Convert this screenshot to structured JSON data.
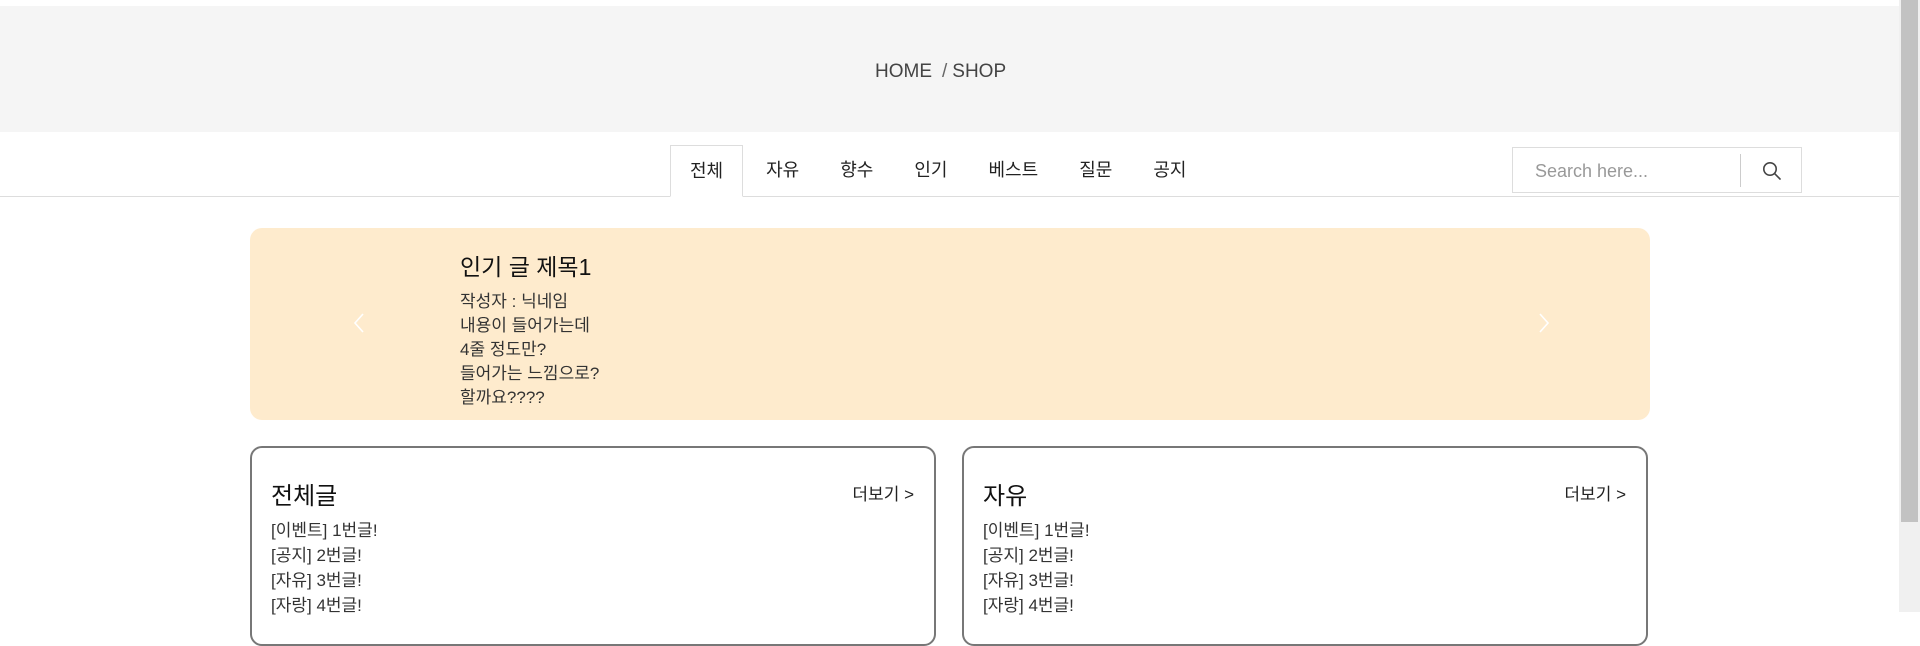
{
  "header": {
    "breadcrumb": {
      "home": "HOME",
      "separator": "/",
      "current": "SHOP"
    }
  },
  "nav": {
    "tabs": [
      {
        "label": "전체",
        "active": true
      },
      {
        "label": "자유"
      },
      {
        "label": "향수"
      },
      {
        "label": "인기"
      },
      {
        "label": "베스트"
      },
      {
        "label": "질문"
      },
      {
        "label": "공지"
      }
    ]
  },
  "search": {
    "placeholder": "Search here...",
    "value": "",
    "icon": "search-icon"
  },
  "carousel": {
    "background_color": "#feebcd",
    "slide": {
      "title": "인기 글 제목1",
      "author": "작성자 : 닉네임",
      "body_lines": [
        "내용이 들어가는데",
        "4줄 정도만?",
        "들어가는 느낌으로?",
        "할까요????"
      ]
    },
    "prev_icon": "chevron-left-icon",
    "next_icon": "chevron-right-icon"
  },
  "boards": [
    {
      "title": "전체글",
      "more_label": "더보기 >",
      "posts": [
        "[이벤트] 1번글!",
        "[공지] 2번글!",
        "[자유] 3번글!",
        "[자랑] 4번글!"
      ]
    },
    {
      "title": "자유",
      "more_label": "더보기 >",
      "posts": [
        "[이벤트] 1번글!",
        "[공지] 2번글!",
        "[자유] 3번글!",
        "[자랑] 4번글!"
      ]
    }
  ]
}
